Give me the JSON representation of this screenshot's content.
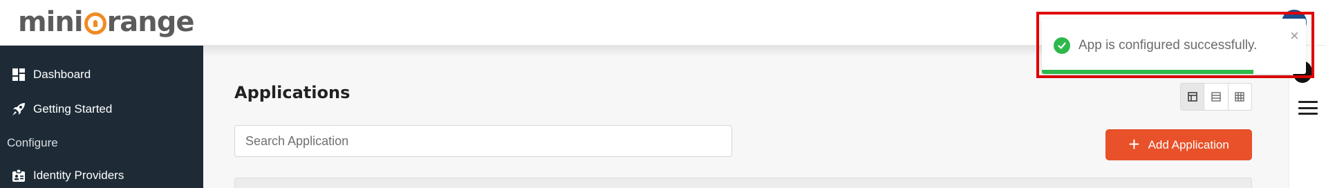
{
  "brand": {
    "logo_left": "mini",
    "logo_right": "range",
    "accent_color": "#f08a24"
  },
  "sidebar": {
    "items": [
      {
        "label": "Dashboard",
        "icon": "dashboard-icon"
      },
      {
        "label": "Getting Started",
        "icon": "rocket-icon"
      }
    ],
    "section_configure": "Configure",
    "items_configure": [
      {
        "label": "Identity Providers",
        "icon": "id-card-icon"
      }
    ]
  },
  "main": {
    "title": "Applications",
    "search_placeholder": "Search Application",
    "add_button_label": "Add Application",
    "add_button_color": "#e8512a",
    "view_modes": [
      {
        "icon": "card-view-icon",
        "active": true
      },
      {
        "icon": "list-view-icon",
        "active": false
      },
      {
        "icon": "grid-view-icon",
        "active": false
      }
    ]
  },
  "toast": {
    "message": "App is configured successfully.",
    "close_symbol": "×",
    "status_color": "#2eb84b",
    "highlight_color": "#e00000",
    "progress_fraction": 0.8
  }
}
